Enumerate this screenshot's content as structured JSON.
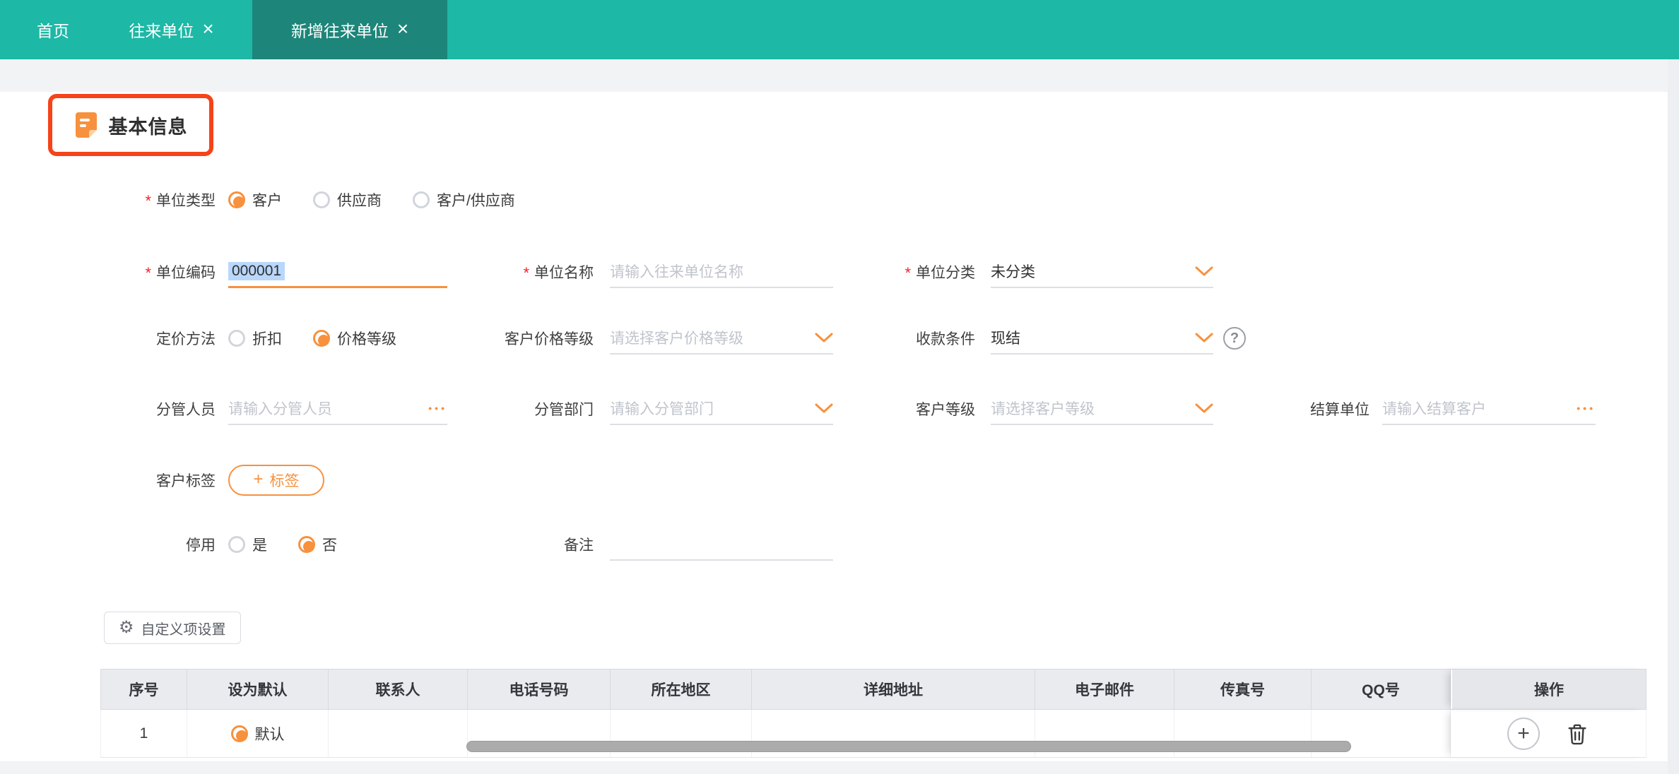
{
  "window": {
    "tabs": [
      {
        "label": "首页",
        "closable": false,
        "active": false
      },
      {
        "label": "往来单位",
        "closable": true,
        "active": false
      },
      {
        "label": "新增往来单位",
        "closable": true,
        "active": true
      }
    ]
  },
  "section": {
    "title": "基本信息"
  },
  "form": {
    "unit_type": {
      "label": "单位类型",
      "required": true,
      "options": [
        {
          "label": "客户",
          "selected": true
        },
        {
          "label": "供应商",
          "selected": false
        },
        {
          "label": "客户/供应商",
          "selected": false
        }
      ]
    },
    "unit_code": {
      "label": "单位编码",
      "required": true,
      "value": "000001",
      "focused": true
    },
    "unit_name": {
      "label": "单位名称",
      "required": true,
      "placeholder": "请输入往来单位名称"
    },
    "unit_category": {
      "label": "单位分类",
      "required": true,
      "value": "未分类"
    },
    "pricing_method": {
      "label": "定价方法",
      "options": [
        {
          "label": "折扣",
          "selected": false
        },
        {
          "label": "价格等级",
          "selected": true
        }
      ]
    },
    "customer_price_level": {
      "label": "客户价格等级",
      "placeholder": "请选择客户价格等级"
    },
    "payment_terms": {
      "label": "收款条件",
      "value": "现结"
    },
    "manager": {
      "label": "分管人员",
      "placeholder": "请输入分管人员"
    },
    "department": {
      "label": "分管部门",
      "placeholder": "请输入分管部门"
    },
    "customer_level": {
      "label": "客户等级",
      "placeholder": "请选择客户等级"
    },
    "settlement_unit": {
      "label": "结算单位",
      "placeholder": "请输入结算客户"
    },
    "customer_tags": {
      "label": "客户标签",
      "button_label": "标签"
    },
    "disabled": {
      "label": "停用",
      "options": [
        {
          "label": "是",
          "selected": false
        },
        {
          "label": "否",
          "selected": true
        }
      ]
    },
    "remark": {
      "label": "备注",
      "value": ""
    }
  },
  "custom_fields_button": {
    "label": "自定义项设置"
  },
  "contacts_table": {
    "headers": [
      "序号",
      "设为默认",
      "联系人",
      "电话号码",
      "所在地区",
      "详细地址",
      "电子邮件",
      "传真号",
      "QQ号",
      "操作"
    ],
    "rows": [
      {
        "seq": "1",
        "default_label": "默认",
        "contact": "",
        "phone": "",
        "region": "",
        "address": "",
        "email": "",
        "fax": "",
        "qq": ""
      }
    ]
  },
  "icons": {
    "close": "×",
    "plus": "+",
    "question": "?",
    "gear": "⚙",
    "required_marker": "*"
  },
  "colors": {
    "accent_orange": "#f7913e",
    "highlight_red": "#f5431a",
    "teal": "#1db8a6",
    "teal_dark": "#1d8579",
    "selection_blue": "#b8d7fb",
    "required_red": "#f5222d"
  }
}
